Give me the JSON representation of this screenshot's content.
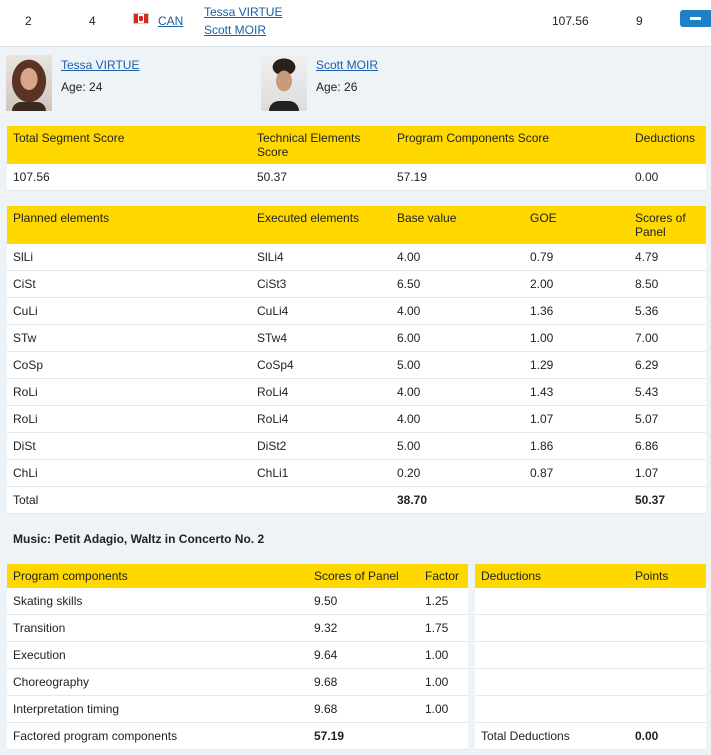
{
  "summary": {
    "rank": "2",
    "start_number": "4",
    "nation": "CAN",
    "skater1": "Tessa VIRTUE",
    "skater2": "Scott MOIR",
    "total_score": "107.56",
    "total_rank": "9"
  },
  "skaters": [
    {
      "name": "Tessa VIRTUE",
      "age": "Age: 24"
    },
    {
      "name": "Scott MOIR",
      "age": "Age: 26"
    }
  ],
  "segment": {
    "headers": [
      "Total Segment Score",
      "Technical Elements Score",
      "Program Components Score",
      "Deductions"
    ],
    "values": [
      "107.56",
      "50.37",
      "57.19",
      "0.00"
    ]
  },
  "elements": {
    "headers": [
      "Planned elements",
      "Executed elements",
      "Base value",
      "GOE",
      "Scores of Panel"
    ],
    "rows": [
      [
        "SlLi",
        "SlLi4",
        "4.00",
        "0.79",
        "4.79"
      ],
      [
        "CiSt",
        "CiSt3",
        "6.50",
        "2.00",
        "8.50"
      ],
      [
        "CuLi",
        "CuLi4",
        "4.00",
        "1.36",
        "5.36"
      ],
      [
        "STw",
        "STw4",
        "6.00",
        "1.00",
        "7.00"
      ],
      [
        "CoSp",
        "CoSp4",
        "5.00",
        "1.29",
        "6.29"
      ],
      [
        "RoLi",
        "RoLi4",
        "4.00",
        "1.43",
        "5.43"
      ],
      [
        "RoLi",
        "RoLi4",
        "4.00",
        "1.07",
        "5.07"
      ],
      [
        "DiSt",
        "DiSt2",
        "5.00",
        "1.86",
        "6.86"
      ],
      [
        "ChLi",
        "ChLi1",
        "0.20",
        "0.87",
        "1.07"
      ]
    ],
    "total": {
      "label": "Total",
      "base": "38.70",
      "panel": "50.37"
    }
  },
  "music": "Music: Petit Adagio, Waltz in Concerto No. 2",
  "components": {
    "headers": [
      "Program components",
      "Scores of Panel",
      "Factor"
    ],
    "rows": [
      [
        "Skating skills",
        "9.50",
        "1.25"
      ],
      [
        "Transition",
        "9.32",
        "1.75"
      ],
      [
        "Execution",
        "9.64",
        "1.00"
      ],
      [
        "Choreography",
        "9.68",
        "1.00"
      ],
      [
        "Interpretation timing",
        "9.68",
        "1.00"
      ]
    ],
    "factored_label": "Factored program components",
    "factored_value": "57.19"
  },
  "deductions": {
    "headers": [
      "Deductions",
      "Points"
    ],
    "total_label": "Total Deductions",
    "total_value": "0.00"
  },
  "colors": {
    "header_yellow": "#ffd800",
    "link_blue": "#1a5fa8",
    "button_blue": "#1f80c8",
    "page_bg": "#eef3f7"
  },
  "icons": {
    "flag": "canada-flag-icon",
    "collapse": "minus-icon"
  }
}
